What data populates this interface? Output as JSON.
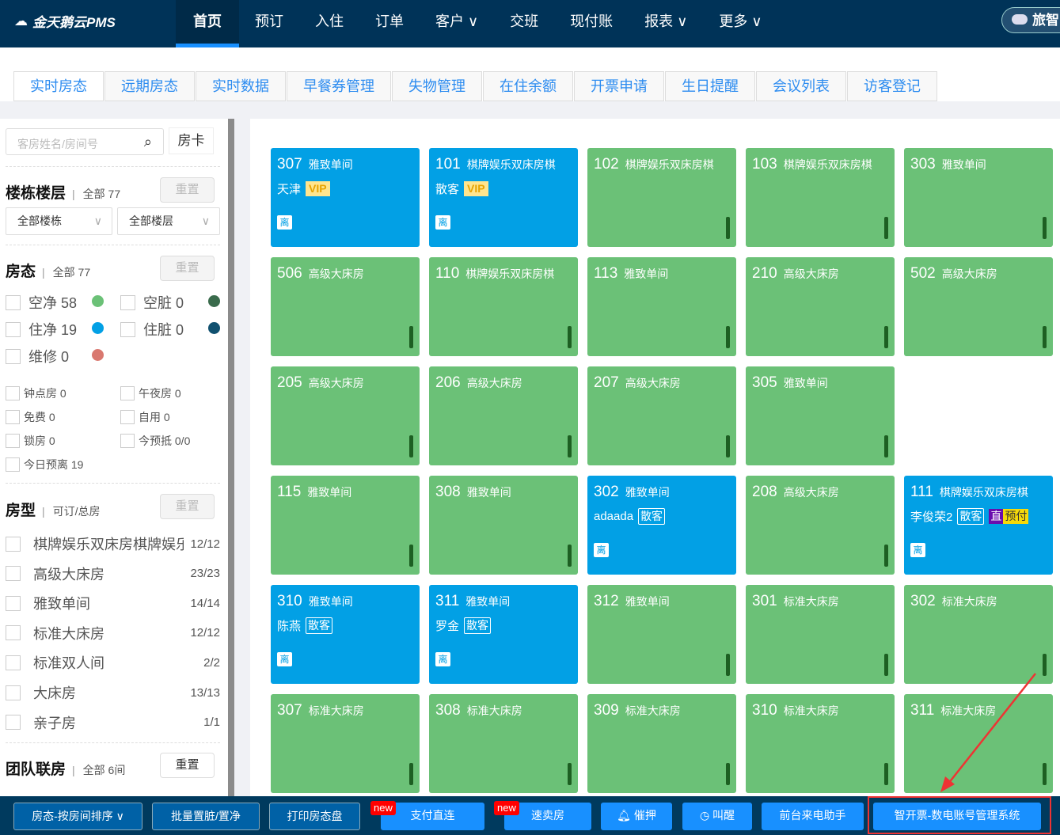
{
  "app": {
    "logo": "金天鹅云PMS",
    "brand": "旅智"
  },
  "nav": [
    "首页",
    "预订",
    "入住",
    "订单",
    "客户 ∨",
    "交班",
    "现付账",
    "报表 ∨",
    "更多 ∨"
  ],
  "subtabs": [
    "实时房态",
    "远期房态",
    "实时数据",
    "早餐券管理",
    "失物管理",
    "在住余额",
    "开票申请",
    "生日提醒",
    "会议列表",
    "访客登记"
  ],
  "sidebar": {
    "search_placeholder": "客房姓名/房间号",
    "room_card": "房卡",
    "building": {
      "title": "楼栋楼层",
      "count": "全部 77",
      "reset": "重置",
      "building_select": "全部楼栋",
      "floor_select": "全部楼层"
    },
    "status": {
      "title": "房态",
      "count": "全部 77",
      "reset": "重置",
      "items": [
        {
          "label": "空净 58",
          "color": "#6bc177"
        },
        {
          "label": "空脏 0",
          "color": "#3a6b4c"
        },
        {
          "label": "住净 19",
          "color": "#02a0e5"
        },
        {
          "label": "住脏 0",
          "color": "#10506f"
        },
        {
          "label": "维修 0",
          "color": "#d9786f"
        }
      ]
    },
    "filters": [
      "钟点房 0",
      "午夜房 0",
      "免费 0",
      "自用 0",
      "锁房 0",
      "今预抵 0/0",
      "今日预离 19"
    ],
    "roomtype": {
      "title": "房型",
      "sub": "可订/总房",
      "reset": "重置",
      "items": [
        {
          "name": "棋牌娱乐双床房棋牌娱乐",
          "count": "12/12"
        },
        {
          "name": "高级大床房",
          "count": "23/23"
        },
        {
          "name": "雅致单间",
          "count": "14/14"
        },
        {
          "name": "标准大床房",
          "count": "12/12"
        },
        {
          "name": "标准双人间",
          "count": "2/2"
        },
        {
          "name": "大床房",
          "count": "13/13"
        },
        {
          "name": "亲子房",
          "count": "1/1"
        }
      ]
    },
    "group": {
      "title": "团队联房",
      "count": "全部 6间",
      "reset": "重置"
    }
  },
  "rooms": [
    {
      "no": "307",
      "type": "雅致单间",
      "occ": true,
      "guest": "天津",
      "tags": [
        "VIP"
      ]
    },
    {
      "no": "101",
      "type": "棋牌娱乐双床房棋",
      "occ": true,
      "guest": "散客",
      "tags": [
        "VIP"
      ]
    },
    {
      "no": "102",
      "type": "棋牌娱乐双床房棋"
    },
    {
      "no": "103",
      "type": "棋牌娱乐双床房棋"
    },
    {
      "no": "303",
      "type": "雅致单间"
    },
    {
      "no": "506",
      "type": "高级大床房"
    },
    {
      "no": "110",
      "type": "棋牌娱乐双床房棋"
    },
    {
      "no": "113",
      "type": "雅致单间"
    },
    {
      "no": "210",
      "type": "高级大床房"
    },
    {
      "no": "502",
      "type": "高级大床房"
    },
    {
      "no": "205",
      "type": "高级大床房"
    },
    {
      "no": "206",
      "type": "高级大床房"
    },
    {
      "no": "207",
      "type": "高级大床房"
    },
    {
      "no": "305",
      "type": "雅致单间"
    },
    null,
    {
      "no": "115",
      "type": "雅致单间"
    },
    {
      "no": "308",
      "type": "雅致单间"
    },
    {
      "no": "302",
      "type": "雅致单间",
      "occ": true,
      "guest": "adaada",
      "tags": [
        "散客"
      ]
    },
    {
      "no": "208",
      "type": "高级大床房"
    },
    {
      "no": "111",
      "type": "棋牌娱乐双床房棋",
      "occ": true,
      "guest": "李俊荣2",
      "tags": [
        "散客",
        "直",
        "预付"
      ]
    },
    {
      "no": "310",
      "type": "雅致单间",
      "occ": true,
      "guest": "陈燕",
      "tags": [
        "散客"
      ]
    },
    {
      "no": "311",
      "type": "雅致单间",
      "occ": true,
      "guest": "罗金",
      "tags": [
        "散客"
      ]
    },
    {
      "no": "312",
      "type": "雅致单间"
    },
    {
      "no": "301",
      "type": "标准大床房"
    },
    {
      "no": "302",
      "type": "标准大床房"
    },
    {
      "no": "307",
      "type": "标准大床房"
    },
    {
      "no": "308",
      "type": "标准大床房"
    },
    {
      "no": "309",
      "type": "标准大床房"
    },
    {
      "no": "310",
      "type": "标准大床房"
    },
    {
      "no": "311",
      "type": "标准大床房"
    }
  ],
  "leave_label": "离",
  "bottom": {
    "sort": "房态-按房间排序 ∨",
    "batch": "批量置脏/置净",
    "print": "打印房态盘",
    "pay": "支付直连",
    "fast": "速卖房",
    "remind": "催押",
    "wake": "叫醒",
    "phone": "前台来电助手",
    "invoice": "智开票-数电账号管理系统",
    "new": "new"
  }
}
